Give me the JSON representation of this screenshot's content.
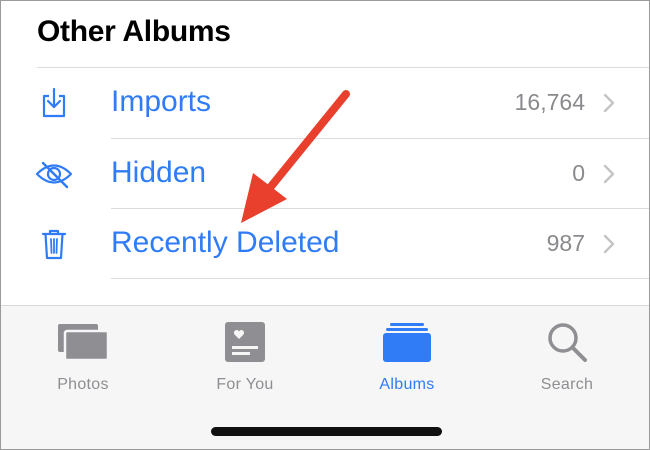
{
  "section": {
    "title": "Other Albums"
  },
  "rows": [
    {
      "label": "Imports",
      "count": "16,764",
      "icon": "import-icon"
    },
    {
      "label": "Hidden",
      "count": "0",
      "icon": "eye-slash-icon"
    },
    {
      "label": "Recently Deleted",
      "count": "987",
      "icon": "trash-icon"
    }
  ],
  "tabbar": {
    "tabs": [
      {
        "label": "Photos",
        "icon": "photos-icon",
        "active": false
      },
      {
        "label": "For You",
        "icon": "for-you-icon",
        "active": false
      },
      {
        "label": "Albums",
        "icon": "albums-icon",
        "active": true
      },
      {
        "label": "Search",
        "icon": "search-icon",
        "active": false
      }
    ]
  },
  "colors": {
    "accent": "#2f7cf6",
    "annotation": "#e8402c",
    "inactive": "#8e8e93"
  }
}
